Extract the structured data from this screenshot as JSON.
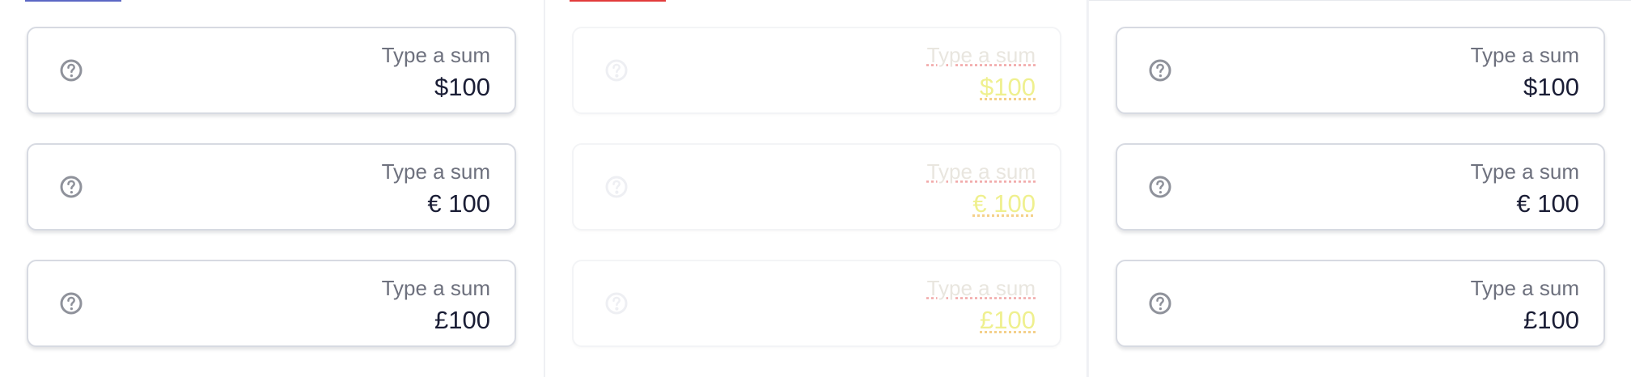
{
  "states": [
    {
      "tab_color": "#5b67c4",
      "fields": [
        {
          "label": "Type a sum",
          "value": "$100",
          "icon": "help-circle-icon"
        },
        {
          "label": "Type a sum",
          "value": "€ 100",
          "icon": "help-circle-icon"
        },
        {
          "label": "Type a sum",
          "value": "£100",
          "icon": "help-circle-icon"
        }
      ]
    },
    {
      "tab_color": "#e23b3b",
      "fields": [
        {
          "label": "Type a sum",
          "value": "$100",
          "icon": "help-circle-icon"
        },
        {
          "label": "Type a sum",
          "value": "€ 100",
          "icon": "help-circle-icon"
        },
        {
          "label": "Type a sum",
          "value": "£100",
          "icon": "help-circle-icon"
        }
      ]
    },
    {
      "fields": [
        {
          "label": "Type a sum",
          "value": "$100",
          "icon": "help-circle-icon"
        },
        {
          "label": "Type a sum",
          "value": "€ 100",
          "icon": "help-circle-icon"
        },
        {
          "label": "Type a sum",
          "value": "£100",
          "icon": "help-circle-icon"
        }
      ]
    }
  ],
  "colors": {
    "label": "#6e717e",
    "value": "#1a1d35",
    "border": "#d7dae2",
    "icon": "#8f929b"
  }
}
